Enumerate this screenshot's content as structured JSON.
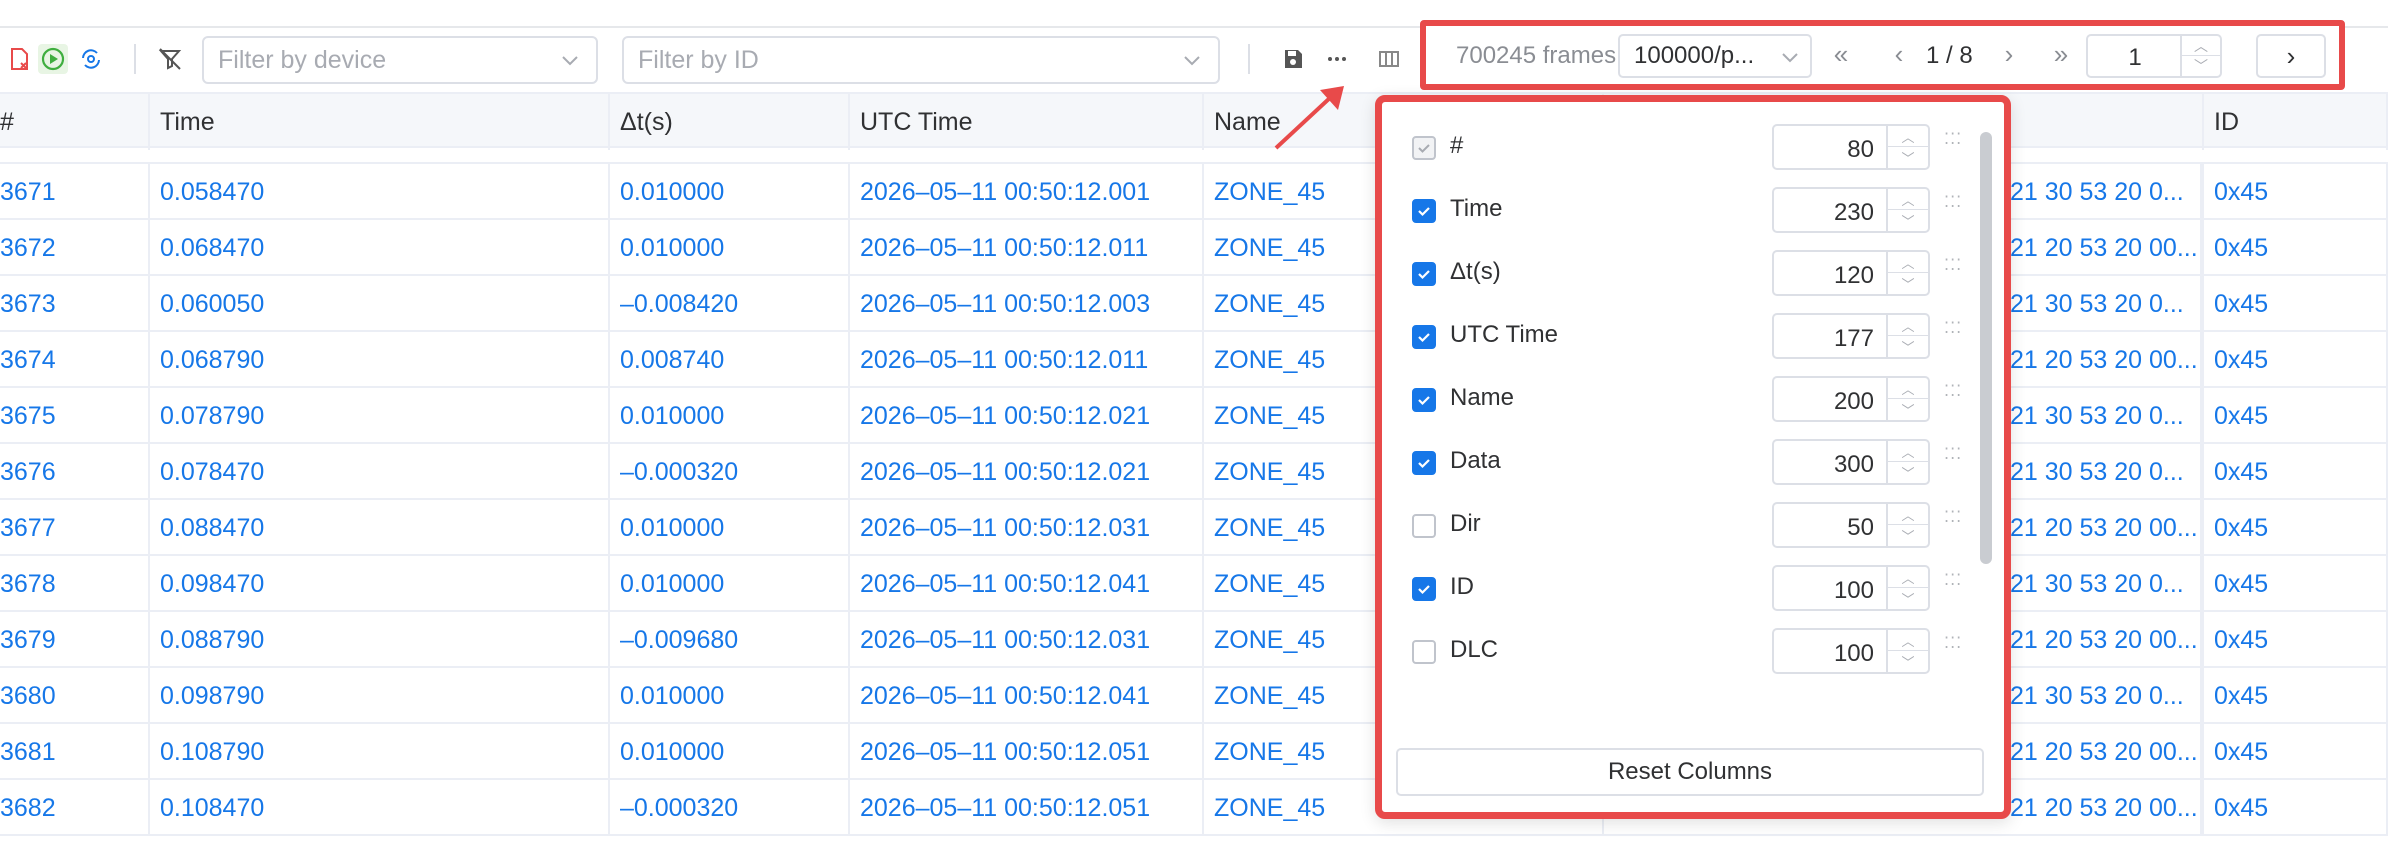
{
  "toolbar": {
    "icons": [
      "clear-file-icon",
      "play-circle-icon",
      "sync-icon",
      "filter-off-icon",
      "save-icon",
      "more-icon",
      "columns-icon"
    ],
    "device_filter_placeholder": "Filter by device",
    "id_filter_placeholder": "Filter by ID"
  },
  "pager": {
    "frames": "700245 frames",
    "page_size": "100000/p...",
    "page_info": "1 / 8",
    "jump_value": "1"
  },
  "table": {
    "headers": [
      "#",
      "Time",
      "Δt(s)",
      "UTC Time",
      "Name",
      "ID"
    ],
    "rows": [
      {
        "num": "3671",
        "time": "0.058470",
        "dt": "0.010000",
        "utc": "2026–05–11 00:50:12.001",
        "name": "ZONE_45",
        "data": "21 30 53 20 0...",
        "id": "0x45"
      },
      {
        "num": "3672",
        "time": "0.068470",
        "dt": "0.010000",
        "utc": "2026–05–11 00:50:12.011",
        "name": "ZONE_45",
        "data": "21 20 53 20 00...",
        "id": "0x45"
      },
      {
        "num": "3673",
        "time": "0.060050",
        "dt": "–0.008420",
        "utc": "2026–05–11 00:50:12.003",
        "name": "ZONE_45",
        "data": "21 30 53 20 0...",
        "id": "0x45"
      },
      {
        "num": "3674",
        "time": "0.068790",
        "dt": "0.008740",
        "utc": "2026–05–11 00:50:12.011",
        "name": "ZONE_45",
        "data": "21 20 53 20 00...",
        "id": "0x45"
      },
      {
        "num": "3675",
        "time": "0.078790",
        "dt": "0.010000",
        "utc": "2026–05–11 00:50:12.021",
        "name": "ZONE_45",
        "data": "21 30 53 20 0...",
        "id": "0x45"
      },
      {
        "num": "3676",
        "time": "0.078470",
        "dt": "–0.000320",
        "utc": "2026–05–11 00:50:12.021",
        "name": "ZONE_45",
        "data": "21 30 53 20 0...",
        "id": "0x45"
      },
      {
        "num": "3677",
        "time": "0.088470",
        "dt": "0.010000",
        "utc": "2026–05–11 00:50:12.031",
        "name": "ZONE_45",
        "data": "21 20 53 20 00...",
        "id": "0x45"
      },
      {
        "num": "3678",
        "time": "0.098470",
        "dt": "0.010000",
        "utc": "2026–05–11 00:50:12.041",
        "name": "ZONE_45",
        "data": "21 30 53 20 0...",
        "id": "0x45"
      },
      {
        "num": "3679",
        "time": "0.088790",
        "dt": "–0.009680",
        "utc": "2026–05–11 00:50:12.031",
        "name": "ZONE_45",
        "data": "21 20 53 20 00...",
        "id": "0x45"
      },
      {
        "num": "3680",
        "time": "0.098790",
        "dt": "0.010000",
        "utc": "2026–05–11 00:50:12.041",
        "name": "ZONE_45",
        "data": "21 30 53 20 0...",
        "id": "0x45"
      },
      {
        "num": "3681",
        "time": "0.108790",
        "dt": "0.010000",
        "utc": "2026–05–11 00:50:12.051",
        "name": "ZONE_45",
        "data": "21 20 53 20 00...",
        "id": "0x45"
      },
      {
        "num": "3682",
        "time": "0.108470",
        "dt": "–0.000320",
        "utc": "2026–05–11 00:50:12.051",
        "name": "ZONE_45",
        "data": "21 20 53 20 00...",
        "id": "0x45"
      }
    ]
  },
  "column_settings": {
    "columns": [
      {
        "name": "#",
        "width": "80",
        "checked": true,
        "disabled": true
      },
      {
        "name": "Time",
        "width": "230",
        "checked": true,
        "disabled": false
      },
      {
        "name": "Δt(s)",
        "width": "120",
        "checked": true,
        "disabled": false
      },
      {
        "name": "UTC Time",
        "width": "177",
        "checked": true,
        "disabled": false
      },
      {
        "name": "Name",
        "width": "200",
        "checked": true,
        "disabled": false
      },
      {
        "name": "Data",
        "width": "300",
        "checked": true,
        "disabled": false
      },
      {
        "name": "Dir",
        "width": "50",
        "checked": false,
        "disabled": false
      },
      {
        "name": "ID",
        "width": "100",
        "checked": true,
        "disabled": false
      },
      {
        "name": "DLC",
        "width": "100",
        "checked": false,
        "disabled": false
      }
    ],
    "reset_label": "Reset Columns"
  },
  "colors": {
    "accent": "#1677e8",
    "highlight": "#e84a4a"
  }
}
